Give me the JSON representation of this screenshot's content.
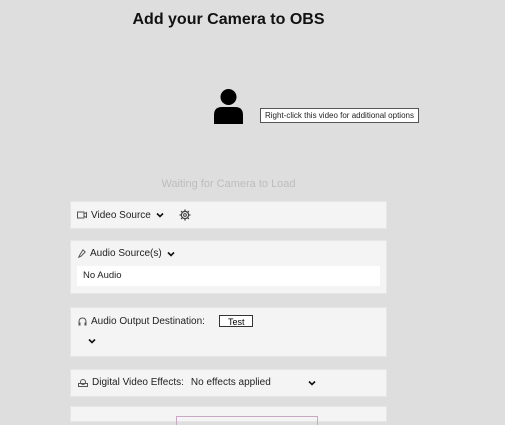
{
  "page": {
    "title": "Add your Camera to OBS"
  },
  "preview": {
    "avatar_icon": "user-silhouette-icon",
    "tooltip": "Right-click this video for additional options",
    "status": "Waiting for Camera to Load"
  },
  "video_source": {
    "icon": "camera-icon",
    "label": "Video Source",
    "settings_icon": "gear-icon"
  },
  "audio_sources": {
    "icon": "microphone-icon",
    "label": "Audio Source(s)",
    "value": "No Audio"
  },
  "audio_output": {
    "icon": "headphones-icon",
    "label": "Audio Output Destination:",
    "test_label": "Test"
  },
  "video_effects": {
    "icon": "effects-icon",
    "label": "Digital Video Effects:",
    "selected": "No effects applied"
  }
}
